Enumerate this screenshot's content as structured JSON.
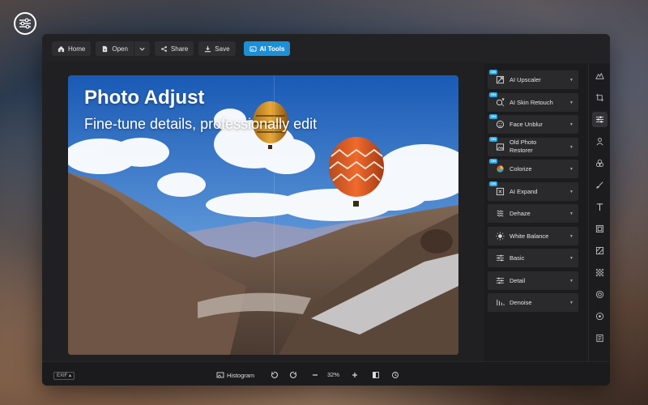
{
  "toolbar": {
    "home_label": "Home",
    "open_label": "Open",
    "share_label": "Share",
    "save_label": "Save",
    "ai_tools_label": "AI Tools"
  },
  "photo": {
    "title": "Photo Adjust",
    "subtitle": "Fine-tune details, professionally edit"
  },
  "panel": {
    "badge": "ON",
    "items": [
      {
        "label": "AI Upscaler",
        "icon": "upscaler-icon",
        "badge": true
      },
      {
        "label": "AI Skin Retouch",
        "icon": "skin-retouch-icon",
        "badge": true
      },
      {
        "label": "Face Unblur",
        "icon": "face-icon",
        "badge": true
      },
      {
        "label": "Old Photo Restorer",
        "icon": "photo-restore-icon",
        "badge": true
      },
      {
        "label": "Colorize",
        "icon": "colorize-icon",
        "badge": true
      },
      {
        "label": "AI Expand",
        "icon": "expand-icon",
        "badge": true
      },
      {
        "label": "Dehaze",
        "icon": "dehaze-icon",
        "badge": false
      },
      {
        "label": "White Balance",
        "icon": "white-balance-icon",
        "badge": false
      },
      {
        "label": "Basic",
        "icon": "sliders-icon",
        "badge": false
      },
      {
        "label": "Detail",
        "icon": "detail-icon",
        "badge": false
      },
      {
        "label": "Denoise",
        "icon": "denoise-icon",
        "badge": false
      }
    ]
  },
  "bottom": {
    "exif_label": "EXIF",
    "histogram_label": "Histogram",
    "zoom": "32%"
  },
  "colors": {
    "accent": "#1d8fd6",
    "badge": "#2aa8e8",
    "window_bg": "#1b1b1d"
  }
}
